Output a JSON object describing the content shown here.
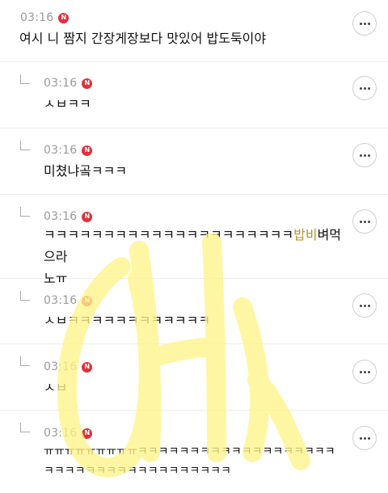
{
  "comments": [
    {
      "time": "03:16",
      "badge": "N",
      "text": "여시 니 짬지 간장게장보다 맛있어 밥도둑이야"
    },
    {
      "time": "03:16",
      "badge": "N",
      "text": "ㅅㅂㅋㅋ"
    },
    {
      "time": "03:16",
      "badge": "N",
      "text": "미쳤냐곸ㅋㅋㅋ"
    },
    {
      "time": "03:16",
      "badge": "N",
      "text_before": "ㅋㅋㅋㅋㅋㅋㅋㅋㅋㅋㅋㅋㅋㅋㅋㅋㅋㅋㅋㅋㅋ",
      "text_highlight": "밥비",
      "text_after": "벼먹으라\n노ㅠ"
    },
    {
      "time": "03:16",
      "badge": "N",
      "text": "ㅅㅂㅋㅋㅋㅋㅋㅋㅋㅋㅋㅋㅋㅋ"
    },
    {
      "time": "03:16",
      "badge": "N",
      "text": "ㅅㅂ"
    },
    {
      "time": "03:16",
      "badge": "N",
      "text": "ㅠㅠㅠㅠㅠㅠㅠㅠㅠㅋㅋㅋㅋㅋㅋㅋㅋㅋㅋㅋㅋㅋㅋㅋㅋㅋㅋㅋ\nㅋㅋㅋㅋㅋㅋㅋㅋㅋㅋㅋㅋㅋㅋㅋㅋㅋㅋ"
    }
  ],
  "icons": {
    "more": "more-options-icon",
    "reply": "reply-arrow-icon",
    "new": "new-badge-icon"
  },
  "colors": {
    "badge": "#e0303b",
    "watermark": "#fff48a",
    "highlight": "#b8942a"
  }
}
